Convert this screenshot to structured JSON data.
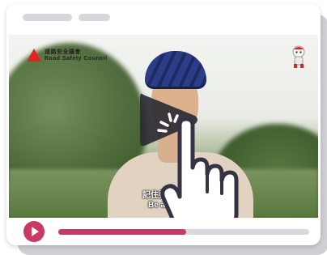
{
  "window": {
    "title_placeholders": [
      "",
      ""
    ]
  },
  "video": {
    "logo_text_line1": "道路安全議會",
    "logo_text_line2": "Road Safety Council",
    "subtitle_line1": "記住要戴",
    "subtitle_line2": "Be alert",
    "overlay_icon": "play-icon",
    "cursor_icon": "hand-pointer-icon",
    "mascot_icon": "mascot-icon"
  },
  "controls": {
    "play_icon": "play-icon",
    "progress_value": 0.51
  },
  "colors": {
    "accent": "#c83a63",
    "track": "#d8d8de",
    "window_bg": "#ffffff",
    "shadow": "#cfcfd4",
    "overlay_play": "#2b2b33"
  }
}
